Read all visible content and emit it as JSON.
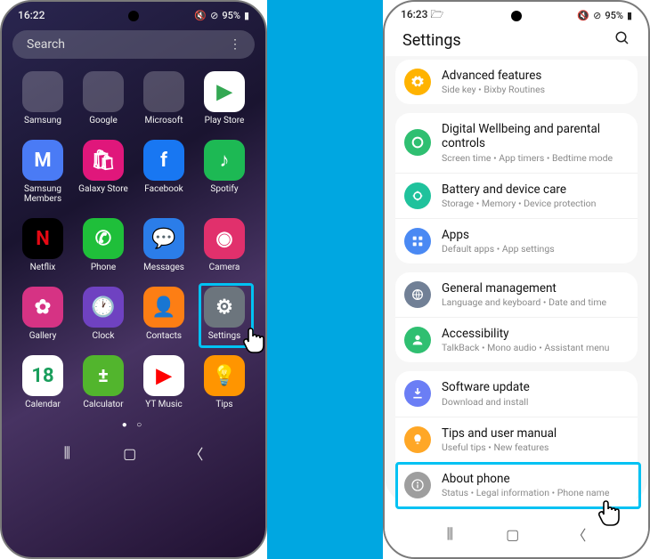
{
  "left": {
    "status": {
      "time": "16:22",
      "battery": "95%",
      "icons": "⟳ ⊘"
    },
    "search_placeholder": "Search",
    "apps": [
      {
        "label": "Samsung",
        "type": "folder"
      },
      {
        "label": "Google",
        "type": "folder"
      },
      {
        "label": "Microsoft",
        "type": "folder"
      },
      {
        "label": "Play Store",
        "bg": "#fff",
        "glyph": "▶",
        "fg": "#34a853"
      },
      {
        "label": "Samsung Members",
        "bg": "#4a7bf5",
        "glyph": "M"
      },
      {
        "label": "Galaxy Store",
        "bg": "#e0177b",
        "glyph": "🛍"
      },
      {
        "label": "Facebook",
        "bg": "#1877f2",
        "glyph": "f"
      },
      {
        "label": "Spotify",
        "bg": "#1db954",
        "glyph": "♪"
      },
      {
        "label": "Netflix",
        "bg": "#000",
        "glyph": "N",
        "fg": "#e50914"
      },
      {
        "label": "Phone",
        "bg": "#1fbf3a",
        "glyph": "✆"
      },
      {
        "label": "Messages",
        "bg": "#2b7de9",
        "glyph": "💬"
      },
      {
        "label": "Camera",
        "bg": "#e1306c",
        "glyph": "◉"
      },
      {
        "label": "Gallery",
        "bg": "#d63384",
        "glyph": "✿"
      },
      {
        "label": "Clock",
        "bg": "#6f42c1",
        "glyph": "🕐"
      },
      {
        "label": "Contacts",
        "bg": "#fd7e14",
        "glyph": "👤"
      },
      {
        "label": "Settings",
        "bg": "#6c757d",
        "glyph": "⚙"
      },
      {
        "label": "Calendar",
        "bg": "#fff",
        "glyph": "18",
        "fg": "#1a9e5c"
      },
      {
        "label": "Calculator",
        "bg": "#52b52d",
        "glyph": "±"
      },
      {
        "label": "YT Music",
        "bg": "#fff",
        "glyph": "▶",
        "fg": "#ff0000"
      },
      {
        "label": "Tips",
        "bg": "#ff9500",
        "glyph": "💡"
      }
    ],
    "highlight_index": 15
  },
  "right": {
    "status": {
      "time": "16:23",
      "battery": "95%",
      "icons": "⟳ ⊘"
    },
    "header": "Settings",
    "groups": [
      [
        {
          "icon_bg": "#ffb300",
          "icon": "gear",
          "title": "Advanced features",
          "sub": "Side key • Bixby Routines"
        }
      ],
      [
        {
          "icon_bg": "#2fbf71",
          "icon": "circle",
          "title": "Digital Wellbeing and parental controls",
          "sub": "Screen time • App timers • Bedtime mode"
        },
        {
          "icon_bg": "#1fc29c",
          "icon": "care",
          "title": "Battery and device care",
          "sub": "Storage • Memory • Device protection"
        },
        {
          "icon_bg": "#4a89f3",
          "icon": "grid",
          "title": "Apps",
          "sub": "Default apps • App settings"
        }
      ],
      [
        {
          "icon_bg": "#718096",
          "icon": "globe",
          "title": "General management",
          "sub": "Language and keyboard • Date and time"
        },
        {
          "icon_bg": "#2fbf71",
          "icon": "person",
          "title": "Accessibility",
          "sub": "TalkBack • Mono audio • Assistant menu"
        }
      ],
      [
        {
          "icon_bg": "#6b7ef5",
          "icon": "download",
          "title": "Software update",
          "sub": "Download and install"
        },
        {
          "icon_bg": "#ffa726",
          "icon": "bulb",
          "title": "Tips and user manual",
          "sub": "Useful tips • New features"
        },
        {
          "icon_bg": "#9e9e9e",
          "icon": "info",
          "title": "About phone",
          "sub": "Status • Legal information • Phone name"
        }
      ]
    ],
    "highlight": {
      "group": 3,
      "row": 2
    }
  }
}
